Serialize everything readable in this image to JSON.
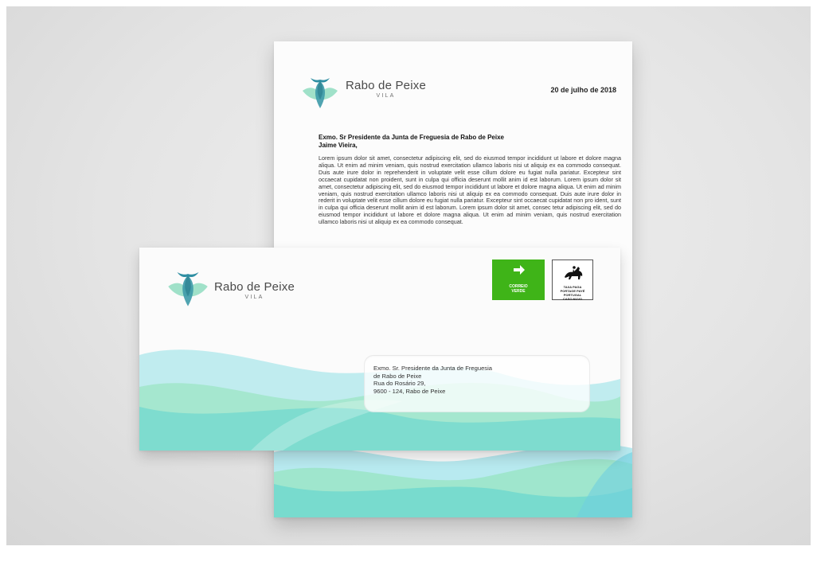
{
  "brand": {
    "name": "Rabo de Peixe",
    "subtitle": "VILA"
  },
  "letter": {
    "date": "20 de julho de 2018",
    "recipient_line1": "Exmo. Sr Presidente da Junta de Freguesia de Rabo de Peixe",
    "recipient_line2": "Jaime Vieira,",
    "body": "Lorem ipsum dolor sit amet, consectetur adipiscing elit, sed do eiusmod tempor incididunt ut labore et dolore magna aliqua. Ut enim ad minim veniam, quis nostrud exercitation ullamco laboris nisi ut aliquip ex ea commodo consequat. Duis aute irure dolor in reprehenderit in voluptate velit esse cillum dolore eu fugiat nulla pariatur. Excepteur sint occaecat cupidatat non proident, sunt in culpa qui officia deserunt mollit anim id est laborum. Lorem ipsum dolor sit amet, consectetur adipiscing elit, sed do eiusmod tempor incididunt ut labore et dolore magna aliqua. Ut enim ad minim veniam, quis nostrud exercitation ullamco laboris nisi ut aliquip ex ea commodo consequat. Duis aute irure dolor in rederit in voluptate velit esse cillum dolore eu fugiat nulla pariatur. Excepteur sint occaecat cupidatat non pro ident, sunt in culpa qui officia deserunt mollit anim id est laborum. Lorem ipsum dolor sit amet, consec tetur adipiscing elit, sed do eiusmod tempor incididunt ut labore et dolore magna aliqua. Ut enim ad minim veniam, quis nostrud exercitation ullamco laboris nisi ut aliquip ex ea commodo consequat."
  },
  "envelope": {
    "stamp_green": {
      "label_line1": "CORREIO",
      "label_line2": "VERDE",
      "icon": "arrow-right-icon"
    },
    "stamp_post": {
      "label_line1": "TAXA PAGA",
      "label_line2": "PORTAGE PAYÉ",
      "label_line3": "PORTUGAL",
      "label_line4": "CASO NUVO",
      "icon": "horse-rider-icon"
    },
    "address": [
      "Exmo. Sr. Presidente da Junta de Freguesia",
      "de Rabo de Peixe",
      "Rua do Rosário 29,",
      "9600 - 124, Rabo de Peixe"
    ]
  },
  "colors": {
    "teal": "#5fd3cf",
    "mint": "#8ee3b5",
    "cyan": "#7fdbe6",
    "logo_green": "#57c08c",
    "logo_blue": "#2f8fa3",
    "stamp_green": "#3fb418"
  }
}
